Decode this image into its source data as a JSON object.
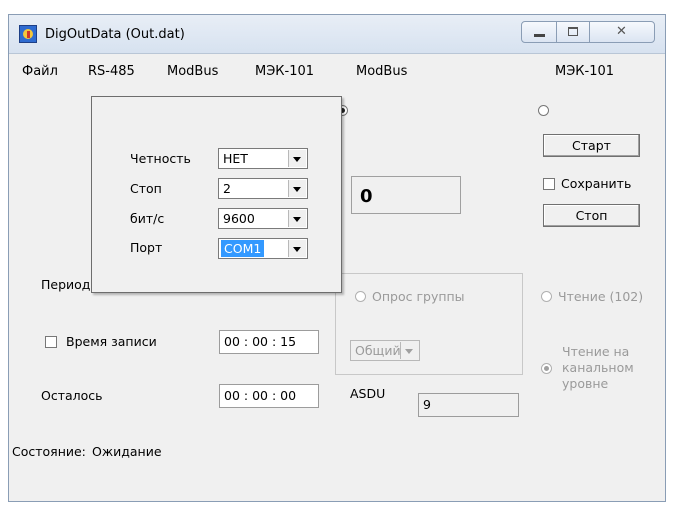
{
  "window": {
    "title": "DigOutData (Out.dat)",
    "app_icon": "app-icon",
    "controls": [
      "minimize-icon",
      "maximize-icon",
      "close-icon"
    ]
  },
  "menu": {
    "file": "Файл",
    "rs485": "RS-485",
    "modbus": "ModBus",
    "iec101": "МЭК-101",
    "radio_modbus": "ModBus",
    "radio_iec101": "МЭК-101",
    "selected_protocol": "ModBus"
  },
  "serial_popup": {
    "parity_label": "Четность",
    "parity_value": "НЕТ",
    "stop_label": "Стоп",
    "stop_value": "2",
    "baud_label": "бит/с",
    "baud_value": "9600",
    "port_label": "Порт",
    "port_value": "COM1"
  },
  "main": {
    "value_display": "0",
    "period_label": "Период",
    "record_time_label": "Время записи",
    "record_time_checked": false,
    "record_time_value": "00 : 00 : 15",
    "remaining_label": "Осталось",
    "remaining_value": "00 : 00 : 00",
    "asdu_label": "ASDU",
    "asdu_value": "9",
    "status_label": "Состояние:",
    "status_value": "Ожидание"
  },
  "group": {
    "poll_group_label": "Опрос группы",
    "group_select_value": "Общий"
  },
  "right_panel": {
    "start_button": "Старт",
    "save_label": "Сохранить",
    "save_checked": false,
    "stop_button": "Стоп",
    "read102_label": "Чтение (102)",
    "read_link_line1": "Чтение на",
    "read_link_line2": "канальном",
    "read_link_line3": "уровне"
  }
}
